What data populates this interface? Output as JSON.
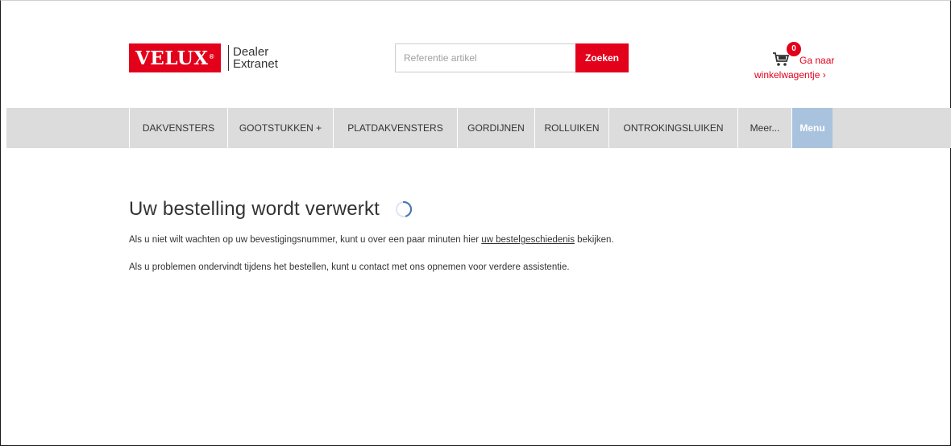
{
  "header": {
    "logo_text": "VELUX",
    "logo_mark": "®",
    "logo_sub_line1": "Dealer",
    "logo_sub_line2": "Extranet",
    "search_placeholder": "Referentie artikel",
    "search_button": "Zoeken",
    "cart_count": "0",
    "cart_label_line1": "Ga naar",
    "cart_label_line2": "winkelwagentje ›"
  },
  "nav": {
    "items": [
      {
        "label": "DAKVENSTERS"
      },
      {
        "label": "GOOTSTUKKEN +"
      },
      {
        "label": "PLATDAKVENSTERS"
      },
      {
        "label": "GORDIJNEN"
      },
      {
        "label": "ROLLUIKEN"
      },
      {
        "label": "ONTROKINGSLUIKEN"
      },
      {
        "label": "Meer..."
      },
      {
        "label": "Menu"
      }
    ]
  },
  "main": {
    "title": "Uw bestelling wordt verwerkt",
    "p1_before": "Als u niet wilt wachten op uw bevestigingsnummer, kunt u over een paar minuten hier ",
    "p1_link": "uw bestelgeschiedenis",
    "p1_after": " bekijken.",
    "p2": "Als u problemen ondervindt tijdens het bestellen, kunt u contact met ons opnemen voor verdere assistentie."
  },
  "colors": {
    "brand_red": "#e2001a",
    "nav_bg": "#dcdcdc",
    "menu_blue": "#a9c3de",
    "spinner_blue": "#4a78b5"
  },
  "icons": {
    "cart": "shopping-cart-icon",
    "spinner": "loading-spinner-icon"
  }
}
